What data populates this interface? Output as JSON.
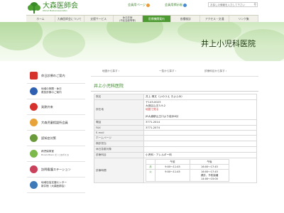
{
  "header": {
    "logo_name": "大森医師会",
    "logo_sub": "Ohmori Medical Association",
    "member_link": "会員用ページ",
    "member_link2": "会員用掲示板",
    "search_placeholder": "お探しの情報を入力して下さい"
  },
  "nav": [
    {
      "label": "ホーム"
    },
    {
      "label": "大森医師会について"
    },
    {
      "label": "支援サービス"
    },
    {
      "label": "休日診療\n(市民会館等等)",
      "two": true
    },
    {
      "label": "医療機関案内",
      "active": true
    },
    {
      "label": "各種検診"
    },
    {
      "label": "アクセス・交通"
    },
    {
      "label": "リンク集"
    }
  ],
  "hero": {
    "title": "井上小児科医院"
  },
  "crumbs": [
    "地図から探す",
    "一覧から探す",
    "診療科目から探す"
  ],
  "sidebar": [
    {
      "label": "休日診療のご案内",
      "icon": "red-cross-icon",
      "color": "#d6322d"
    },
    {
      "label": "地域の夜間・休日\n救急診療のご案内",
      "icon": "ambulance-icon",
      "color": "#2f5fb0"
    },
    {
      "label": "発熱外来",
      "icon": "thermometer-icon",
      "color": "#d6322d"
    },
    {
      "label": "大森児童相談所会員",
      "icon": "child-icon",
      "color": "#e8a23a"
    },
    {
      "label": "認知症対策",
      "icon": "brain-icon",
      "color": "#6a9a3a"
    },
    {
      "label": "病児保育室",
      "sub": "Pinnolo Bosco (ピッコロボスコ)",
      "icon": "baby-icon",
      "color": "#7db84a"
    },
    {
      "label": "訪問看護ステーション",
      "icon": "nurse-icon",
      "color": "#c9415a"
    },
    {
      "label": "地域包括支援センター\n新井宿（大森医師会）",
      "icon": "house-icon",
      "color": "#3d7ab8"
    }
  ],
  "main": {
    "title": "井上小児科医院",
    "rows": [
      {
        "k": "院名",
        "v": "井上 清文（いのうえ きよふみ）"
      },
      {
        "k": "所在地",
        "v": "〒143-0023\n大田区山王3-9-2\n地図で見る\n\nJR大森駅山王口より徒歩8分",
        "link": "地図で見る"
      },
      {
        "k": "電話",
        "v": "3771-2014"
      },
      {
        "k": "FAX",
        "v": "3771-2074"
      },
      {
        "k": "E-mail",
        "v": ""
      },
      {
        "k": "ホームページ",
        "v": ""
      },
      {
        "k": "検診担当",
        "v": ""
      },
      {
        "k": "休日急患対象",
        "v": ""
      },
      {
        "k": "診療科目",
        "v": "小児科・アレルギー科"
      }
    ],
    "hours_header": [
      "",
      "午前",
      "午後"
    ],
    "hours": [
      {
        "day": "月",
        "am": "9:00〜11:45",
        "pm": "16:00〜17:45"
      },
      {
        "day": "火",
        "am": "9:00〜11:45",
        "pm": "16:00〜17:45\n健診、予防接種\n14:00〜15:00"
      }
    ],
    "hours_label": "診療時間"
  }
}
